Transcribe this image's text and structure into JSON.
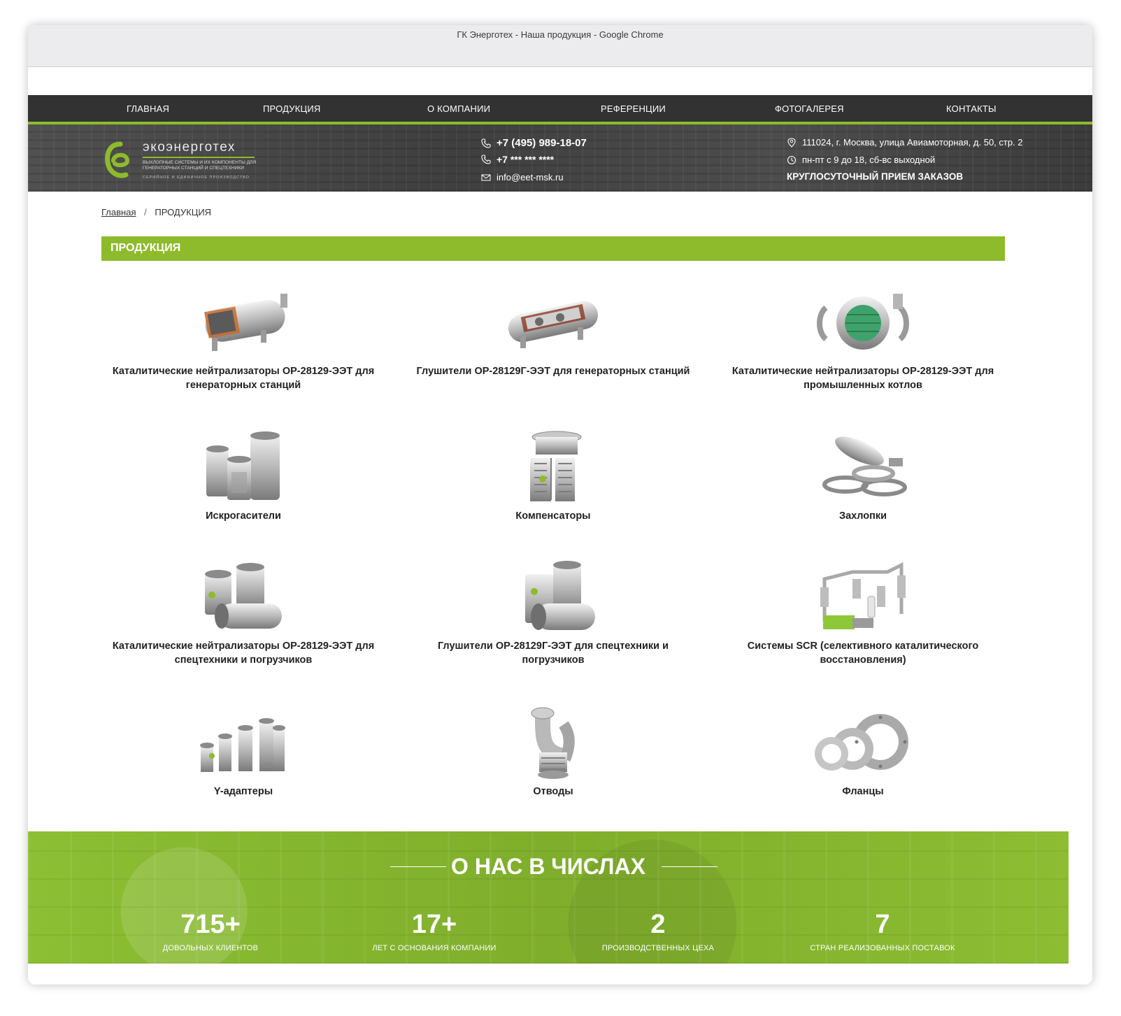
{
  "window": {
    "title": "ГК Энерготех - Наша продукция - Google Chrome"
  },
  "nav": {
    "items": [
      "ГЛАВНАЯ",
      "ПРОДУКЦИЯ",
      "О КОМПАНИИ",
      "РЕФЕРЕНЦИИ",
      "ФОТОГАЛЕРЕЯ",
      "КОНТАКТЫ"
    ]
  },
  "header": {
    "logo_name": "экоэнерготех",
    "logo_subtitle": "ВЫХЛОПНЫЕ СИСТЕМЫ И ИХ КОМПОНЕНТЫ ДЛЯ ГЕНЕРАТОРНЫХ СТАНЦИЙ И СПЕЦТЕХНИКИ",
    "logo_tagline": "СЕРИЙНОЕ И ЕДИНИЧНОЕ ПРОИЗВОДСТВО",
    "phone1": "+7 (495) 989-18-07",
    "phone2": "+7 *** *** ****",
    "email": "info@eet-msk.ru",
    "address": "111024, г. Москва, улица Авиамоторная, д. 50, стр. 2",
    "hours": "пн-пт с 9 до 18, сб-вс выходной",
    "orders": "КРУГЛОСУТОЧНЫЙ ПРИЕМ ЗАКАЗОВ"
  },
  "breadcrumb": {
    "home": "Главная",
    "separator": "/",
    "current": "ПРОДУКЦИЯ"
  },
  "section_title": "ПРОДУКЦИЯ",
  "products": [
    {
      "name": "Каталитические нейтрализаторы ОР-28129-ЭЭТ для генераторных станций",
      "icon": "catalytic-converter-cutaway-icon"
    },
    {
      "name": "Глушители ОР-28129Г-ЭЭТ для генераторных станций",
      "icon": "silencer-cutaway-icon"
    },
    {
      "name": "Каталитические нейтрализаторы ОР-28129-ЭЭТ для промышленных котлов",
      "icon": "boiler-catalyst-icon"
    },
    {
      "name": "Искрогасители",
      "icon": "spark-arrestor-icon"
    },
    {
      "name": "Компенсаторы",
      "icon": "expansion-joint-icon"
    },
    {
      "name": "Захлопки",
      "icon": "rain-cap-icon"
    },
    {
      "name": "Каталитические нейтрализаторы ОР-28129-ЭЭТ для спецтехники и погрузчиков",
      "icon": "vehicle-catalyst-icon"
    },
    {
      "name": "Глушители ОР-28129Г-ЭЭТ для спецтехники и погрузчиков",
      "icon": "vehicle-silencer-icon"
    },
    {
      "name": "Системы SCR (селективного каталитического восстановления)",
      "icon": "scr-system-icon"
    },
    {
      "name": "Y-адаптеры",
      "icon": "y-adapter-icon"
    },
    {
      "name": "Отводы",
      "icon": "elbow-pipe-icon"
    },
    {
      "name": "Фланцы",
      "icon": "flange-icon"
    }
  ],
  "stats": {
    "title": "О НАС В ЧИСЛАХ",
    "items": [
      {
        "value": "715+",
        "label": "ДОВОЛЬНЫХ КЛИЕНТОВ"
      },
      {
        "value": "17+",
        "label": "ЛЕТ С ОСНОВАНИЯ КОМПАНИИ"
      },
      {
        "value": "2",
        "label": "ПРОИЗВОДСТВЕННЫХ ЦЕХА"
      },
      {
        "value": "7",
        "label": "СТРАН РЕАЛИЗОВАННЫХ ПОСТАВОК"
      }
    ]
  },
  "colors": {
    "accent": "#8dbb2b",
    "nav_bg": "#323232",
    "header_bg": "#4a4a4a"
  }
}
